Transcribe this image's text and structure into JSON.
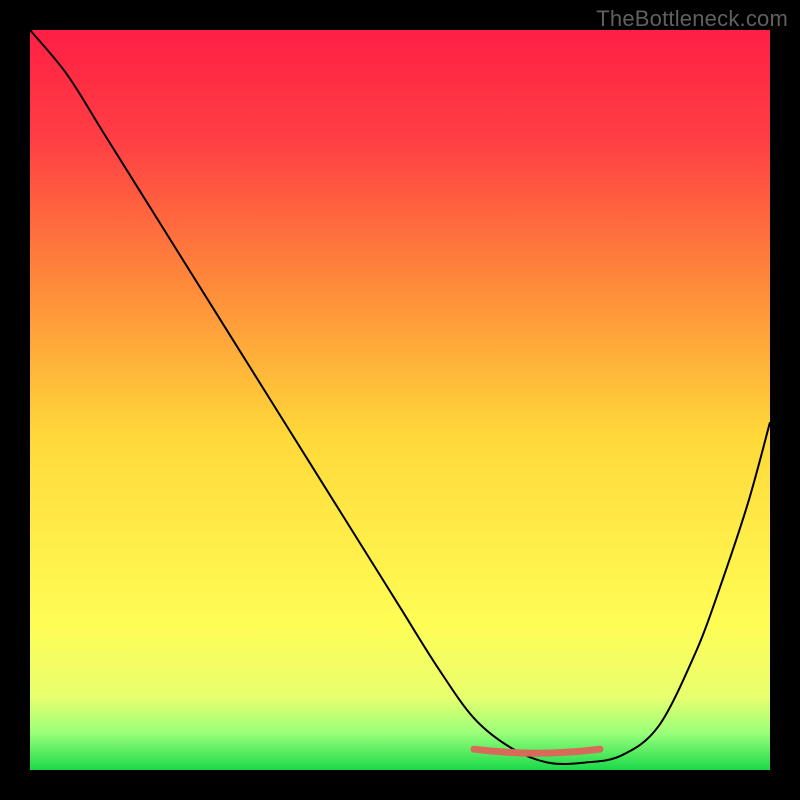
{
  "watermark": "TheBottleneck.com",
  "chart_data": {
    "type": "line",
    "title": "",
    "xlabel": "",
    "ylabel": "",
    "xlim": [
      0,
      100
    ],
    "ylim": [
      0,
      100
    ],
    "grid": false,
    "background": {
      "type": "vertical-gradient",
      "stops": [
        {
          "offset": 0.0,
          "color": "#ff1f44"
        },
        {
          "offset": 0.15,
          "color": "#ff3f44"
        },
        {
          "offset": 0.35,
          "color": "#ff8c3a"
        },
        {
          "offset": 0.55,
          "color": "#ffd93a"
        },
        {
          "offset": 0.8,
          "color": "#fffd55"
        },
        {
          "offset": 0.9,
          "color": "#e9ff6e"
        },
        {
          "offset": 0.95,
          "color": "#9aff7a"
        },
        {
          "offset": 1.0,
          "color": "#1bd94a"
        }
      ]
    },
    "series": [
      {
        "name": "bottleneck-curve",
        "color": "#000000",
        "stroke_width": 2,
        "x": [
          0,
          5,
          10,
          15,
          20,
          25,
          30,
          35,
          40,
          45,
          50,
          55,
          60,
          65,
          70,
          75,
          80,
          85,
          90,
          93,
          97,
          100
        ],
        "values": [
          100,
          94,
          86,
          78,
          70,
          62,
          54,
          46,
          38,
          30,
          22,
          14,
          7,
          3,
          1,
          1,
          2,
          6,
          16,
          24,
          36,
          47
        ]
      }
    ],
    "highlight": {
      "name": "optimal-range",
      "color": "#d86a5a",
      "stroke_width": 7,
      "xrange": [
        60,
        77
      ],
      "yvalue": 2
    }
  }
}
